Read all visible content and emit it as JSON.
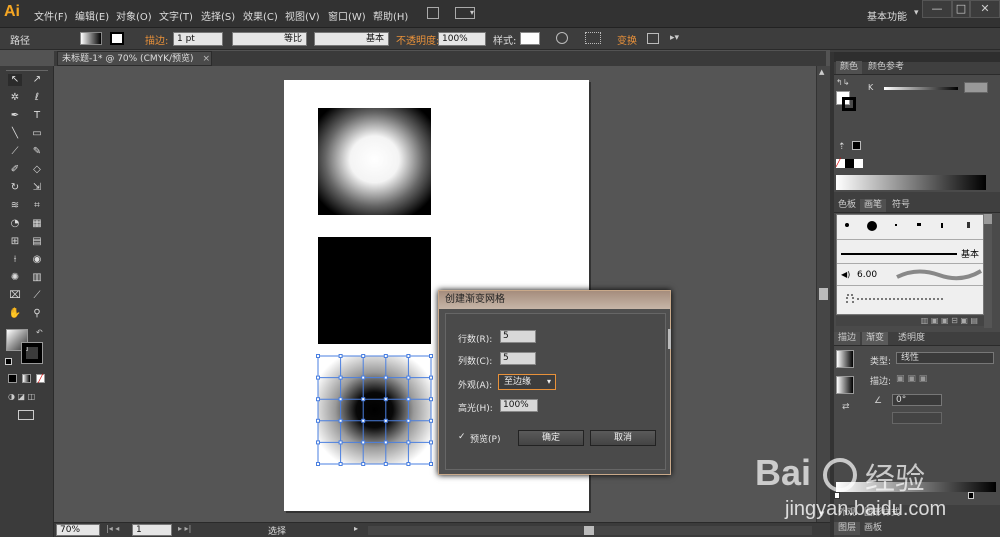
{
  "app": {
    "logo": "Ai"
  },
  "menu": [
    "文件(F)",
    "编辑(E)",
    "对象(O)",
    "文字(T)",
    "选择(S)",
    "效果(C)",
    "视图(V)",
    "窗口(W)",
    "帮助(H)"
  ],
  "workspace": "基本功能",
  "window_controls": [
    "—",
    "□",
    "✕"
  ],
  "control_bar": {
    "path_label": "路径",
    "stroke_label": "描边:",
    "stroke_value": "1 pt",
    "stroke_style": "等比",
    "brush_style": "基本",
    "opacity_label": "不透明度:",
    "opacity_value": "100%",
    "style_label": "样式:",
    "transform_label": "变换"
  },
  "document_tab": {
    "title": "未标题-1* @ 70% (CMYK/预览)",
    "close": "×"
  },
  "status_bar": {
    "zoom": "70%",
    "page": "1",
    "tool_label": "选择"
  },
  "dialog": {
    "title": "创建渐变网格",
    "rows_label": "行数(R):",
    "rows_value": "5",
    "cols_label": "列数(C):",
    "cols_value": "5",
    "appearance_label": "外观(A):",
    "appearance_value": "至边缘",
    "highlight_label": "高光(H):",
    "highlight_value": "100%",
    "preview_label": "预览(P)",
    "preview_checked": true,
    "ok_label": "确定",
    "cancel_label": "取消"
  },
  "panels": {
    "color_tabs": [
      "颜色",
      "颜色参考"
    ],
    "color_channel": "K",
    "swatch_tabs": [
      "色板",
      "画笔",
      "符号"
    ],
    "brush_basic": "基本",
    "brush_size": "6.00",
    "gradient_tabs": [
      "描边",
      "渐变",
      "透明度"
    ],
    "gradient_type_label": "类型:",
    "gradient_type_value": "线性",
    "gradient_stroke_label": "描边:",
    "gradient_angle": "0°",
    "appearance_tabs": [
      "外观",
      "图形样式"
    ],
    "layers_tabs": [
      "图层",
      "画板"
    ]
  },
  "watermark": {
    "brand": "Bai",
    "brand2": "经验",
    "url": "jingyan.baidu.com"
  },
  "colors": {
    "accent_orange": "#e8913a",
    "mesh_blue": "#4a7fe0",
    "ui_dark": "#323232",
    "dialog_border": "#c9a98a"
  }
}
